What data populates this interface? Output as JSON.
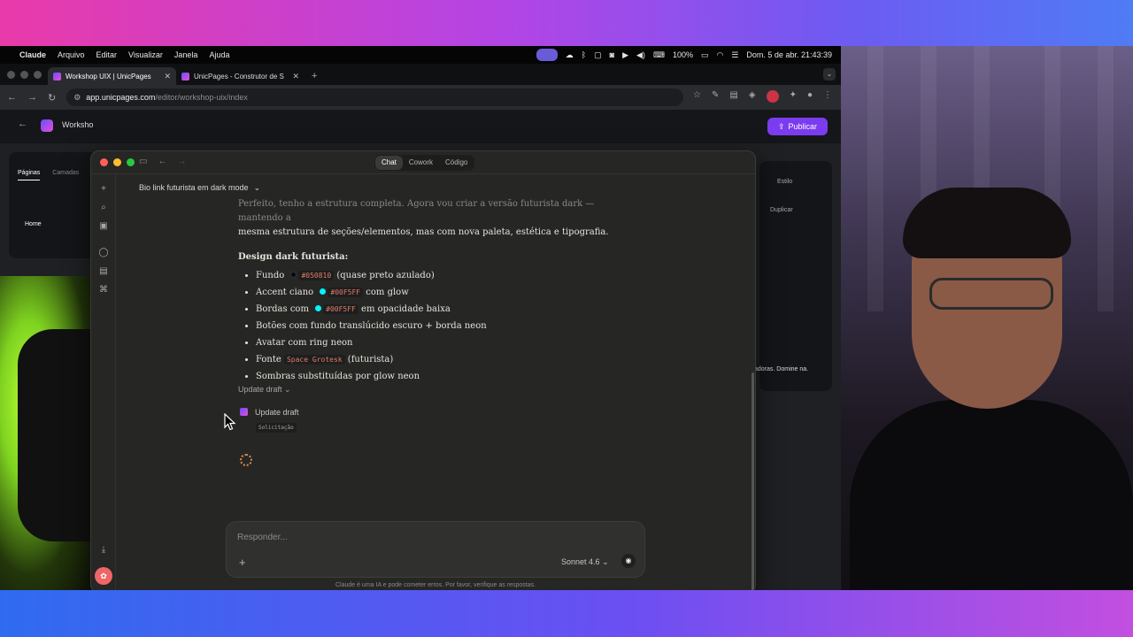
{
  "menubar": {
    "app": "Claude",
    "items": [
      "Arquivo",
      "Editar",
      "Visualizar",
      "Janela",
      "Ajuda"
    ],
    "battery": "100%",
    "datetime": "Dom. 5 de abr. 21:43:39"
  },
  "browser": {
    "tabs": [
      {
        "title": "Workshop UIX | UnicPages"
      },
      {
        "title": "UnicPages - Construtor de S"
      }
    ],
    "url_host": "app.unicpages.com",
    "url_path": "/editor/workshop-uix/index"
  },
  "editor": {
    "workspace": "Worksho",
    "publish": "Publicar",
    "left_tabs": [
      "Páginas",
      "Camadas"
    ],
    "page_home": "Home",
    "right_tab": "Estilo",
    "duplicate": "Duplicar",
    "tail_text": "adoras. Domine na."
  },
  "claude": {
    "modes": [
      "Chat",
      "Cowork",
      "Código"
    ],
    "active_mode": "Chat",
    "conversation_title": "Bio link futurista em dark mode",
    "intro_faded": "Perfeito, tenho a estrutura completa. Agora vou criar a versão futurista dark — mantendo a",
    "intro": "mesma estrutura de seções/elementos, mas com nova paleta, estética e tipografia.",
    "heading": "Design dark futurista:",
    "bullets": [
      {
        "pre": "Fundo",
        "swatch": "#050810",
        "code": "#050810",
        "post": "(quase preto azulado)"
      },
      {
        "pre": "Accent ciano",
        "swatch": "#00F5FF",
        "code": "#00F5FF",
        "post": "com glow"
      },
      {
        "pre": "Bordas com",
        "swatch": "#00F5FF",
        "code": "#00F5FF",
        "post": "em opacidade baixa"
      },
      {
        "pre": "Botões com fundo translúcido escuro + borda neon"
      },
      {
        "pre": "Avatar com ring neon"
      },
      {
        "pre": "Fonte",
        "code": "Space Grotesk",
        "post": "(futurista)"
      },
      {
        "pre": "Sombras substituídas por glow neon"
      }
    ],
    "update_toggle": "Update draft",
    "tool_name": "Update draft",
    "tool_sub": "Solicitação",
    "composer_placeholder": "Responder...",
    "model": "Sonnet 4.6",
    "disclaimer": "Claude é uma IA e pode cometer erros. Por favor, verifique as respostas."
  },
  "colors": {
    "accent_purple": "#7b3cf0",
    "claude_bg": "#262624",
    "traffic_red": "#ff5f57",
    "traffic_yellow": "#febc2e",
    "traffic_green": "#28c840"
  }
}
